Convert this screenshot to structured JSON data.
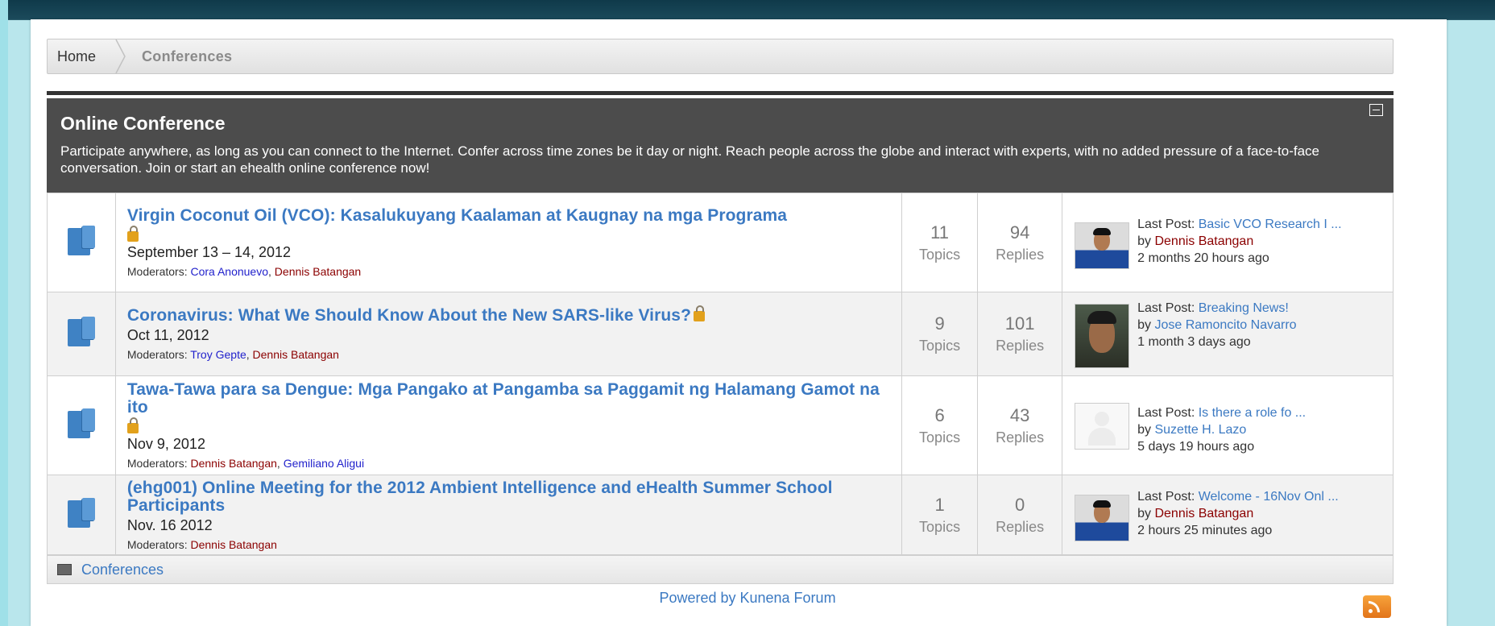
{
  "breadcrumb": {
    "home": "Home",
    "current": "Conferences"
  },
  "category": {
    "title": "Online Conference",
    "description": "Participate anywhere, as long as you can connect to the Internet. Confer across time zones be it day or night. Reach people across the globe and interact with experts, with no added pressure of a face-to-face conversation. Join or start an ehealth online conference now!"
  },
  "forums": [
    {
      "title": "Virgin Coconut Oil (VCO): Kasalukuyang Kaalaman at Kaugnay na mga Programa",
      "date": "September 13 – 14, 2012",
      "moderators_label": "Moderators:",
      "moderators": [
        "Cora Anonuevo",
        "Dennis Batangan"
      ],
      "topics": "11",
      "topics_label": "Topics",
      "replies": "94",
      "replies_label": "Replies",
      "last_post_label": "Last Post:",
      "last_post_title": "Basic VCO Research I ...",
      "by_label": "by",
      "last_post_user": "Dennis Batangan",
      "last_post_time": "2 months 20 hours ago"
    },
    {
      "title": "Coronavirus: What We Should Know About the New SARS-like Virus?",
      "date": "Oct 11, 2012",
      "moderators_label": "Moderators:",
      "moderators": [
        "Troy Gepte",
        "Dennis Batangan"
      ],
      "topics": "9",
      "topics_label": "Topics",
      "replies": "101",
      "replies_label": "Replies",
      "last_post_label": "Last Post:",
      "last_post_title": "Breaking News!",
      "by_label": "by",
      "last_post_user": "Jose Ramoncito Navarro",
      "last_post_time": "1 month 3 days ago"
    },
    {
      "title": "Tawa-Tawa para sa Dengue: Mga Pangako at Pangamba sa Paggamit ng Halamang Gamot na ito",
      "date": "Nov 9, 2012",
      "moderators_label": "Moderators:",
      "moderators": [
        "Dennis Batangan",
        "Gemiliano Aligui"
      ],
      "topics": "6",
      "topics_label": "Topics",
      "replies": "43",
      "replies_label": "Replies",
      "last_post_label": "Last Post:",
      "last_post_title": "Is there a role fo ...",
      "by_label": "by",
      "last_post_user": "Suzette H. Lazo",
      "last_post_time": "5 days 19 hours ago"
    },
    {
      "title": "(ehg001) Online Meeting for the 2012 Ambient Intelligence and eHealth Summer School Participants",
      "date": "Nov. 16 2012",
      "moderators_label": "Moderators:",
      "moderators": [
        "Dennis Batangan"
      ],
      "topics": "1",
      "topics_label": "Topics",
      "replies": "0",
      "replies_label": "Replies",
      "last_post_label": "Last Post:",
      "last_post_title": "Welcome - 16Nov Onl ...",
      "by_label": "by",
      "last_post_user": "Dennis Batangan",
      "last_post_time": "2 hours 25 minutes ago"
    }
  ],
  "footer": {
    "category_link": "Conferences",
    "powered_by": "Powered by Kunena Forum"
  },
  "icons": {
    "forum": "folder-icon",
    "locked": "lock-icon",
    "collapse": "collapse-icon",
    "rss": "rss-icon"
  }
}
